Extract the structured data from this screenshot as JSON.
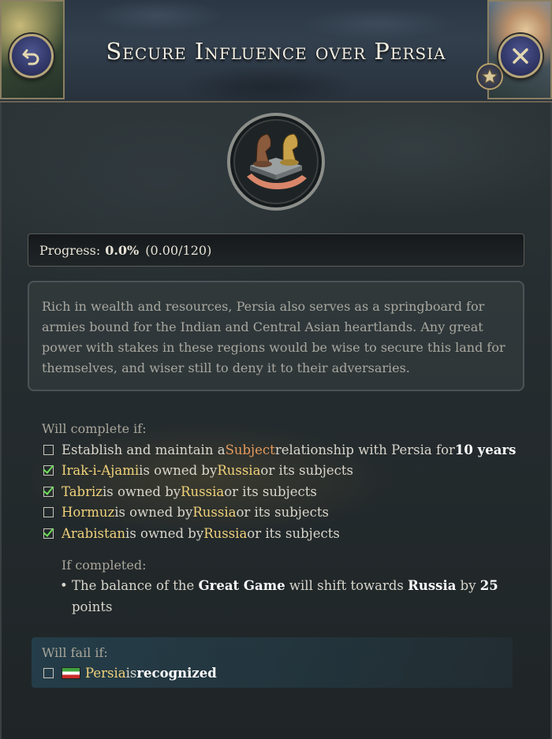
{
  "header": {
    "title": "Secure Influence over Persia",
    "back_icon": "undo-arrow-icon",
    "close_icon": "close-x-icon",
    "star_icon": "star-icon"
  },
  "emblem": {
    "icon": "chess-knights-in-hands-icon"
  },
  "progress": {
    "label": "Progress:",
    "percent": "0.0%",
    "raw": "(0.00/120)",
    "fraction": 0.0
  },
  "description": "Rich in wealth and resources, Persia also serves as a springboard for armies bound for the Indian and Central Asian heartlands. Any great power with stakes in these regions would be wise to secure this land for themselves, and wiser still to deny it to their adversaries.",
  "will_complete": {
    "heading": "Will complete if:",
    "conditions": [
      {
        "checked": false,
        "parts": [
          "Establish and maintain a ",
          "Subject",
          " relationship with Persia for ",
          "10 years"
        ]
      },
      {
        "checked": true,
        "parts": [
          "Irak-i-Ajami",
          " is owned by ",
          "Russia",
          " or its subjects"
        ]
      },
      {
        "checked": true,
        "parts": [
          "Tabriz",
          " is owned by ",
          "Russia",
          " or its subjects"
        ]
      },
      {
        "checked": false,
        "parts": [
          "Hormuz",
          " is owned by ",
          "Russia",
          " or its subjects"
        ]
      },
      {
        "checked": true,
        "parts": [
          "Arabistan",
          " is owned by ",
          "Russia",
          " or its subjects"
        ]
      }
    ]
  },
  "if_completed": {
    "heading": "If completed:",
    "bullet": "•",
    "line1": [
      "The balance of the ",
      "Great Game",
      " will shift towards ",
      "Russia",
      " by ",
      "25"
    ],
    "line2": "points"
  },
  "will_fail": {
    "heading": "Will fail if:",
    "flag_icon": "persia-flag-icon",
    "parts": [
      "Persia",
      " is ",
      "recognized"
    ]
  },
  "colors": {
    "accent_yellow": "#f1d27a",
    "accent_orange": "#e69a5c",
    "check_green": "#6ee05a",
    "button_blue": "#2d3260"
  }
}
